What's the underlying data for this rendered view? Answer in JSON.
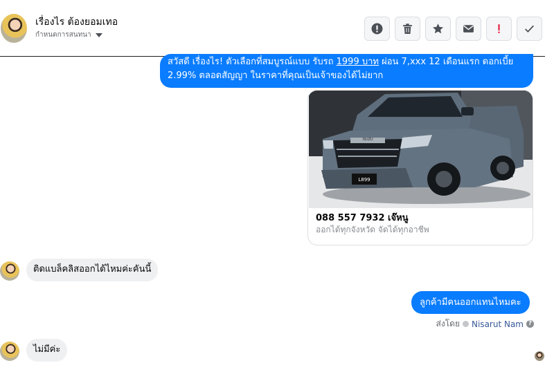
{
  "header": {
    "name": "เรื่องไร ต้องยอมเทอ",
    "subtitle": "กำหนดการสนทนา",
    "actions": [
      {
        "name": "report-icon"
      },
      {
        "name": "trash-icon"
      },
      {
        "name": "star-icon"
      },
      {
        "name": "mail-icon"
      },
      {
        "name": "important-icon"
      },
      {
        "name": "check-icon"
      }
    ]
  },
  "messages": {
    "m1": {
      "part1": "สวัสดี เรื่องไร! ตัวเลือกที่สมบูรณ์แบบ รับรถ ",
      "link": "1999 บาท",
      "part2": " ผ่อน 7,xxx 12 เดือนแรก ดอกเบี้ย 2.99% ตลอดสัญญา ในราคาที่คุณเป็นเจ้าของได้ไม่ยาก"
    },
    "card": {
      "title": "088 557 7932 เจ๊หนู",
      "description": "ออกได้ทุกจังหวัด จัดได้ทุกอาชีพ",
      "plate": "L899",
      "brand": "ISUZU"
    },
    "m2": "ติดแบล็คลิสออกได้ไหมค่ะคันนี้",
    "m3": "ลูกค้ามีคนออกแทนไหมคะ",
    "sent_by": {
      "label": "ส่งโดย",
      "name": "Nisarut Nam"
    },
    "m4": "ไม่มีค่ะ"
  },
  "colors": {
    "outgoing": "#0a7cff",
    "incoming": "#eff0f2",
    "important": "#e41e3f"
  }
}
